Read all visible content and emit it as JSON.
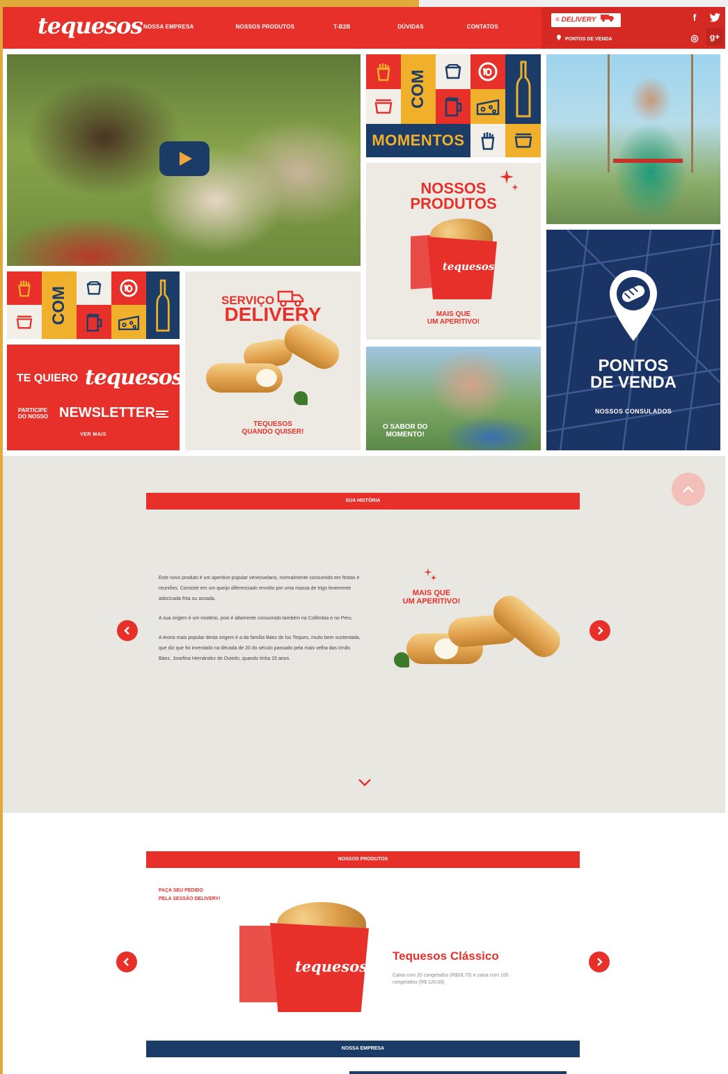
{
  "brand": {
    "logo_text": "tequesos"
  },
  "nav": {
    "items": [
      "NOSSA EMPRESA",
      "NOSSOS PRODUTOS",
      "T-B2B",
      "DÚVIDAS",
      "CONTATOS"
    ]
  },
  "header_right": {
    "delivery_label": "DELIVERY",
    "pontos_label": "PONTOS DE VENDA"
  },
  "social": {
    "facebook": "f",
    "twitter": "t",
    "instagram": "◎",
    "googleplus": "g+"
  },
  "tiles": {
    "com_label": "COM",
    "momentos_label": "MOMENTOS",
    "produtos_title_line1": "NOSSOS",
    "produtos_title_line2": "PRODUTOS",
    "produtos_sub_line1": "MAIS QUE",
    "produtos_sub_line2": "UM APERITIVO!",
    "box_brand": "tequesos",
    "pontos_title_line1": "PONTOS",
    "pontos_title_line2": "DE VENDA",
    "pontos_sub": "NOSSOS CONSULADOS",
    "nl_te_quiero": "TE QUIERO",
    "nl_logo": "tequesos",
    "nl_participe_line1": "PARTICIPE",
    "nl_participe_line2": "DO NOSSO",
    "nl_newsletter": "NEWSLETTER",
    "nl_ver_mais": "VER MAIS",
    "dl_servico": "SERVIÇO",
    "dl_delivery": "DELIVERY",
    "dl_sub_line1": "TEQUESOS",
    "dl_sub_line2": "QUANDO QUISER!",
    "sabor_line1": "O SABOR DO",
    "sabor_line2": "MOMENTO!"
  },
  "historia": {
    "section_title": "SUA HISTÓRIA",
    "paragraphs": [
      "Este novo produto é um aperitivo popular venezuelano, normalmente consumido em festas e reuniões. Consiste em um queijo diferenciado envolto por uma massa de trigo levemente adocicada frita ou assada.",
      "A sua origem é um mistério, pois é altamente consumido também na Colômbia e no Peru.",
      "A teoria mais popular desta origem é a da família Báez de los Teques, muito bem sustentada, que diz que foi inventado na década de 20 do século passado pela mais velha das irmãs Báez, Josefina Hernández de Oviedo, quando tinha 15 anos."
    ],
    "mais_que_line1": "MAIS QUE",
    "mais_que_line2": "UM APERITIVO!"
  },
  "produtos": {
    "section_title": "NOSSOS PRODUTOS",
    "faca_line1": "FAÇA SEU PEDIDO",
    "faca_line2": "PELA SESSÃO DELIVERY!",
    "product_name": "Tequesos Clássico",
    "product_desc": "Caixa com 20 congelados (R$28,70) e caixa com 100 congelados (R$ 120,00)",
    "box_brand": "tequesos"
  },
  "empresa": {
    "section_title": "NOSSA EMPRESA"
  },
  "colors": {
    "brand_red": "#e7302a",
    "navy": "#1c3c68",
    "gold": "#f0b02c",
    "historia_bg": "#e9e7e2"
  }
}
